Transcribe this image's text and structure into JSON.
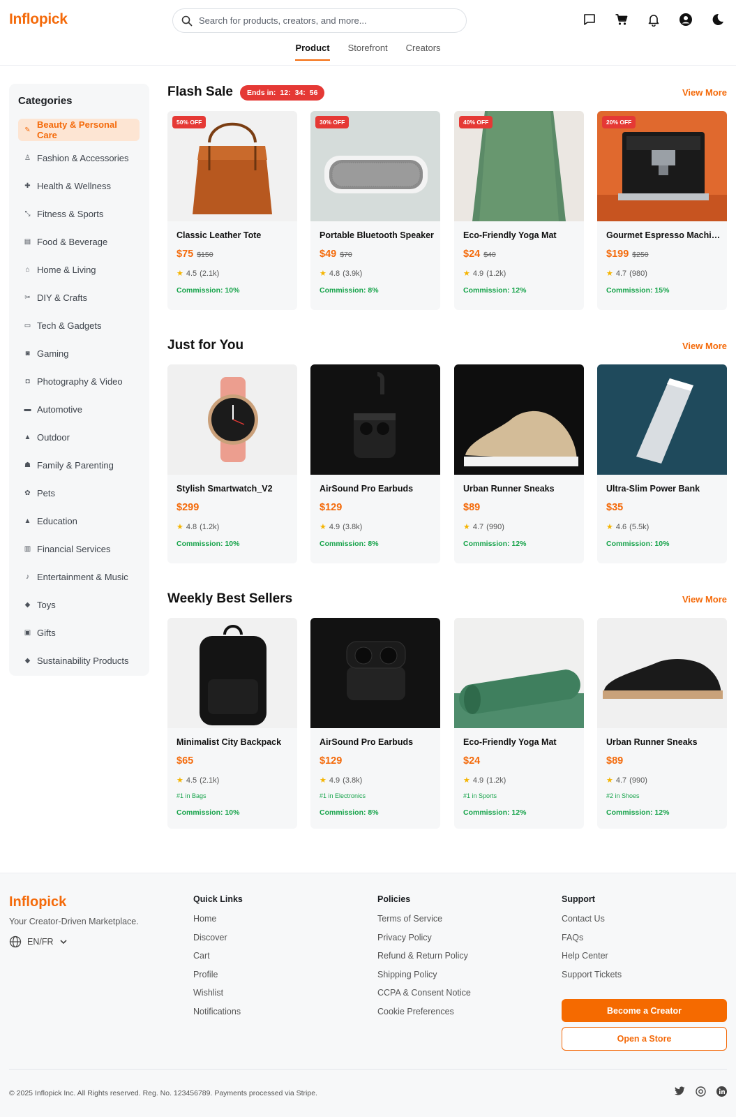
{
  "app": {
    "logo": "Inflopick"
  },
  "search": {
    "placeholder": "Search for products, creators, and more..."
  },
  "header": {
    "icons": [
      "chat-icon",
      "cart-icon",
      "bell-icon",
      "account-icon",
      "dark-mode-icon"
    ]
  },
  "tabs": [
    {
      "label": "Product",
      "active": true
    },
    {
      "label": "Storefront"
    },
    {
      "label": "Creators"
    }
  ],
  "sidebar": {
    "title": "Categories",
    "items": [
      {
        "label": "Beauty & Personal Care",
        "active": true
      },
      {
        "label": "Fashion & Accessories"
      },
      {
        "label": "Health & Wellness"
      },
      {
        "label": "Fitness & Sports"
      },
      {
        "label": "Food & Beverage"
      },
      {
        "label": "Home & Living"
      },
      {
        "label": "DIY & Crafts"
      },
      {
        "label": "Tech & Gadgets"
      },
      {
        "label": "Gaming"
      },
      {
        "label": "Photography & Video"
      },
      {
        "label": "Automotive"
      },
      {
        "label": "Outdoor"
      },
      {
        "label": "Family & Parenting"
      },
      {
        "label": "Pets"
      },
      {
        "label": "Education"
      },
      {
        "label": "Financial Services"
      },
      {
        "label": "Entertainment & Music"
      },
      {
        "label": "Toys"
      },
      {
        "label": "Gifts"
      },
      {
        "label": "Sustainability Products"
      }
    ]
  },
  "flash": {
    "title": "Flash Sale",
    "timer_label": "Ends in:",
    "timer": {
      "h": "12:",
      "m": "34:",
      "s": "56"
    },
    "view_more": "View More",
    "products": [
      {
        "badge": "50% OFF",
        "name": "Classic Leather Tote",
        "price": "$75",
        "old": "$150",
        "rating": "4.5",
        "reviews": "(2.1k)",
        "commission": "Commission: 10%"
      },
      {
        "badge": "30% OFF",
        "name": "Portable Bluetooth Speaker",
        "price": "$49",
        "old": "$70",
        "rating": "4.8",
        "reviews": "(3.9k)",
        "commission": "Commission: 8%"
      },
      {
        "badge": "40% OFF",
        "name": "Eco-Friendly Yoga Mat",
        "price": "$24",
        "old": "$40",
        "rating": "4.9",
        "reviews": "(1.2k)",
        "commission": "Commission: 12%"
      },
      {
        "badge": "20% OFF",
        "name": "Gourmet Espresso Machine",
        "price": "$199",
        "old": "$250",
        "rating": "4.7",
        "reviews": "(980)",
        "commission": "Commission: 15%"
      }
    ]
  },
  "jfy": {
    "title": "Just for You",
    "view_more": "View More",
    "products": [
      {
        "name": "Stylish Smartwatch_V2",
        "price": "$299",
        "rating": "4.8",
        "reviews": "(1.2k)",
        "commission": "Commission: 10%"
      },
      {
        "name": "AirSound Pro Earbuds",
        "price": "$129",
        "rating": "4.9",
        "reviews": "(3.8k)",
        "commission": "Commission: 8%"
      },
      {
        "name": "Urban Runner Sneaks",
        "price": "$89",
        "rating": "4.7",
        "reviews": "(990)",
        "commission": "Commission: 12%"
      },
      {
        "name": "Ultra-Slim Power Bank",
        "price": "$35",
        "rating": "4.6",
        "reviews": "(5.5k)",
        "commission": "Commission: 10%"
      }
    ]
  },
  "best": {
    "title": "Weekly Best Sellers",
    "view_more": "View More",
    "products": [
      {
        "name": "Minimalist City Backpack",
        "price": "$65",
        "rating": "4.5",
        "reviews": "(2.1k)",
        "rank": "#1 in Bags",
        "commission": "Commission: 10%"
      },
      {
        "name": "AirSound Pro Earbuds",
        "price": "$129",
        "rating": "4.9",
        "reviews": "(3.8k)",
        "rank": "#1 in Electronics",
        "commission": "Commission: 8%"
      },
      {
        "name": "Eco-Friendly Yoga Mat",
        "price": "$24",
        "rating": "4.9",
        "reviews": "(1.2k)",
        "rank": "#1 in Sports",
        "commission": "Commission: 12%"
      },
      {
        "name": "Urban Runner Sneaks",
        "price": "$89",
        "rating": "4.7",
        "reviews": "(990)",
        "rank": "#2 in Shoes",
        "commission": "Commission: 12%"
      }
    ]
  },
  "footer": {
    "logo": "Inflopick",
    "tagline": "Your Creator-Driven Marketplace.",
    "lang": "EN/FR",
    "quick": {
      "title": "Quick Links",
      "links": [
        "Home",
        "Discover",
        "Cart",
        "Profile",
        "Wishlist",
        "Notifications"
      ]
    },
    "policies": {
      "title": "Policies",
      "links": [
        "Terms of Service",
        "Privacy Policy",
        "Refund & Return Policy",
        "Shipping Policy",
        "CCPA & Consent Notice",
        "Cookie Preferences"
      ]
    },
    "support": {
      "title": "Support",
      "links": [
        "Contact Us",
        "FAQs",
        "Help Center",
        "Support Tickets"
      ]
    },
    "become_creator": "Become a Creator",
    "open_store": "Open a Store",
    "copyright": "© 2025 Inflopick Inc. All Rights reserved. Reg. No. 123456789. Payments processed via Stripe."
  },
  "colors": {
    "brand": "#f46a0a",
    "sale": "#e53935",
    "commission": "#16a34a",
    "star": "#f5b400"
  }
}
